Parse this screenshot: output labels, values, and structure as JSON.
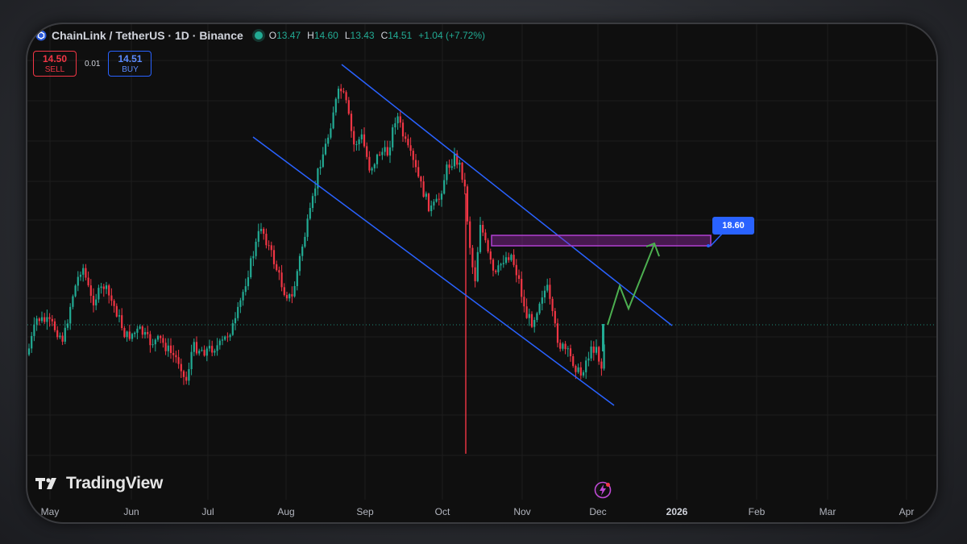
{
  "header": {
    "symbol": "ChainLink / TetherUS · 1D · Binance",
    "open_label": "O",
    "open": "13.47",
    "high_label": "H",
    "high": "14.60",
    "low_label": "L",
    "low": "13.43",
    "close_label": "C",
    "close": "14.51",
    "change": "+1.04 (+7.72%)"
  },
  "trade": {
    "sell_price": "14.50",
    "sell_label": "SELL",
    "spread": "0.01",
    "buy_price": "14.51",
    "buy_label": "BUY"
  },
  "brand": {
    "name": "TradingView"
  },
  "annotation": {
    "target": "18.60"
  },
  "time_axis": [
    "May",
    "Jun",
    "Jul",
    "Aug",
    "Sep",
    "Oct",
    "Nov",
    "Dec",
    "2026",
    "Feb",
    "Mar",
    "Apr"
  ],
  "colors": {
    "up": "#22ab94",
    "down": "#f23645",
    "channel": "#2962ff",
    "zone": "#9c27b0",
    "projection": "#4caf50",
    "background": "#0f0f0f"
  },
  "chart_data": {
    "type": "candlestick",
    "title": "ChainLink / TetherUS · 1D · Binance",
    "current_price": 14.51,
    "target_price": 18.6,
    "channel": "descending",
    "projection_path": "up toward 18.60 zone",
    "approx_price_path": [
      [
        "May",
        14.2
      ],
      [
        "mid-May",
        16.5
      ],
      [
        "Jun",
        14.0
      ],
      [
        "late Jun",
        12.5
      ],
      [
        "Jul",
        14.0
      ],
      [
        "late Jul",
        18.5
      ],
      [
        "Aug",
        16.0
      ],
      [
        "mid-Aug",
        26.5
      ],
      [
        "Sep",
        23.0
      ],
      [
        "mid-Sep",
        24.5
      ],
      [
        "Oct",
        22.0
      ],
      [
        "Oct crash low",
        10.0
      ],
      [
        "late Oct",
        18.0
      ],
      [
        "Nov",
        15.0
      ],
      [
        "late Nov",
        12.5
      ],
      [
        "Dec",
        14.51
      ]
    ]
  }
}
